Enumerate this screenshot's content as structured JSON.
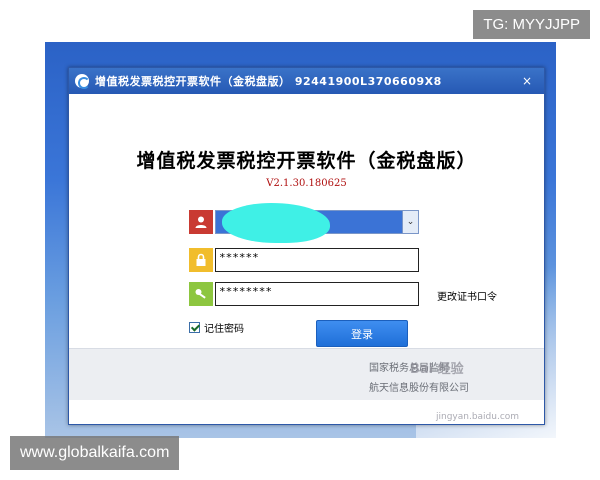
{
  "overlays": {
    "top_right": "TG: MYYJJPP",
    "bottom_left": "www.globalkaifa.com"
  },
  "window": {
    "title": "增值税发票税控开票软件（金税盘版） 92441900L3706609X8",
    "close": "×"
  },
  "app": {
    "title": "增值税发票税控开票软件（金税盘版）",
    "version": "V2.1.30.180625"
  },
  "form": {
    "user_dropdown_arrow": "⌄",
    "password_value": "******",
    "cert_password_value": "********",
    "change_cert_label": "更改证书口令",
    "remember_label": "记住密码",
    "remember_checked": true,
    "login_label": "登录"
  },
  "footer": {
    "line1": "国家税务总局监制",
    "line2": "航天信息股份有限公司"
  },
  "watermark": {
    "text": "Bai 经验",
    "url": "jingyan.baidu.com"
  },
  "colors": {
    "titlebar": "#2659b4",
    "user_icon_bg": "#c93a32",
    "lock_icon_bg": "#f1bd2c",
    "key_icon_bg": "#8dc63f",
    "login_btn": "#1f6fd8",
    "version_text": "#b01010"
  },
  "icons": [
    "app-logo-icon",
    "close-icon",
    "user-icon",
    "lock-icon",
    "key-icon",
    "chevron-down-icon",
    "check-icon"
  ]
}
